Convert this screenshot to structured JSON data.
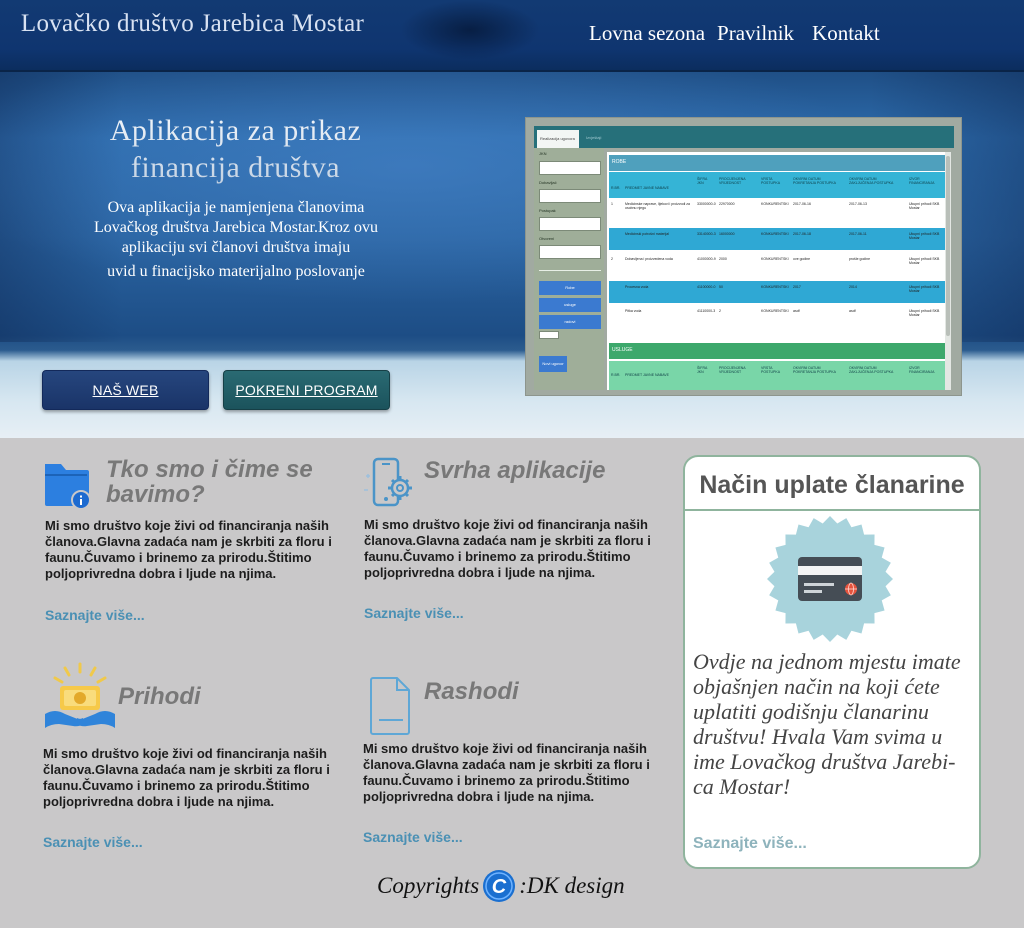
{
  "header": {
    "site_title": "Lovačko društvo Jarebica Mostar",
    "nav": [
      "Lovna sezona",
      "Pravilnik",
      "Kontakt"
    ]
  },
  "hero": {
    "heading": "Aplikacija za prikaz financija društva",
    "text": "Ova aplikacija je namjenjena članovima Lovačkog društva Jarebica Mostar.Kroz ovu aplikaciju svi članovi društva imaju",
    "text_last": "uvid u finacijsko materijalno poslovanje",
    "buttons": {
      "web": "NAŠ WEB",
      "run": "POKRENI PROGRAM"
    }
  },
  "app_preview": {
    "tabs": [
      "Realizacija ugovora",
      "Izvještaji"
    ],
    "sidebar_labels": [
      "JKN",
      "Dobavljač",
      "Postupak",
      "Otvoreni"
    ],
    "sidebar_buttons": [
      "Robe",
      "usluge",
      "radovi"
    ],
    "new_contract_button": "Novi ugovor",
    "section_goods": "ROBE",
    "section_services": "USLUGE",
    "columns": [
      "R.BR.",
      "PREDMET JAVNE NABAVE",
      "ŠIFRA JKN",
      "PROCIJENJENA VRIJEDNOST",
      "VRSTA POSTUPKA",
      "OKVIRNI DATUM POKRETANJA POSTUPKA",
      "OKVIRNI DATUM ZAKLJUČENJA POSTUPKA",
      "IZVOR FINANCIRANJA"
    ],
    "rows": [
      [
        "1",
        "Medicinske naprave, lijekovi i proizvodi za osobnu njegu",
        "33000000-0",
        "22970000",
        "KONKURENTSKI",
        "2017-06-16",
        "2017-06-13",
        "Ukupni prihodi SKB Mostar"
      ],
      [
        "",
        "Medicinski potrošni materijal",
        "33140000-3",
        "16000000",
        "KONKURENTSKI",
        "2017-06-18",
        "2017-06-11",
        "Ukupni prihodi SKB Mostar"
      ],
      [
        "2",
        "Dobavljena i proizvedena voda",
        "41000000-9",
        "2000",
        "KONKURENTSKI",
        "ove godine",
        "prošle godine",
        "Ukupni prihodi SKB Mostar"
      ],
      [
        "",
        "Procesna voda",
        "41100000-0",
        "50",
        "KONKURENTSKI",
        "2017",
        "2014",
        "Ukupni prihodi SKB Mostar"
      ],
      [
        "",
        "Pitka voda",
        "41110000-3",
        "2",
        "KONKURENTSKI",
        "asdf",
        "asdf",
        "Ukupni prihodi SKB Mostar"
      ]
    ]
  },
  "features": [
    {
      "title": "Tko smo i čime se bavimo?",
      "text": "Mi smo društvo koje živi od financiranja naših članova.Glavna zadaća nam je skrbiti za floru i faunu.Čuvamo i brinemo za prirodu.Štitimo poljoprivredna dobra i ljude na njima.",
      "link": "Saznajte više..."
    },
    {
      "title": "Svrha aplikacije",
      "text": "Mi smo društvo koje živi od financiranja naših članova.Glavna zadaća nam je skrbiti za floru i faunu.Čuvamo i brinemo za prirodu.Štitimo poljoprivredna dobra i ljude na njima.",
      "link": "Saznajte više..."
    },
    {
      "title": "Prihodi",
      "text": "Mi smo društvo koje živi od financiranja naših članova.Glavna zadaća nam je skrbiti za floru i faunu.Čuvamo i brinemo za prirodu.Štitimo poljoprivredna dobra i ljude na njima.",
      "link": "Saznajte više..."
    },
    {
      "title": "Rashodi",
      "text": "Mi smo društvo koje živi od financiranja naših članova.Glavna zadaća nam je skrbiti za floru i faunu.Čuvamo i brinemo za prirodu.Štitimo poljoprivredna dobra i ljude na njima.",
      "link": "Saznajte više..."
    }
  ],
  "membership": {
    "title": "Način uplate članarine",
    "text": "Ovdje na jednom mjestu imate objašnjen način na koji ćete uplatiti godišnju članarinu društvu! Hvala Vam svima u ime Lovačkog društva Jarebi-ca Mostar!",
    "link": "Saznajte više..."
  },
  "footer": {
    "before": "Copyrights",
    "badge": "C",
    "after": ":DK design"
  },
  "colors": {
    "header": "#0f3570",
    "link": "#4a90b4",
    "card_border": "#8fb49d",
    "badge": "#1a6fd0"
  }
}
